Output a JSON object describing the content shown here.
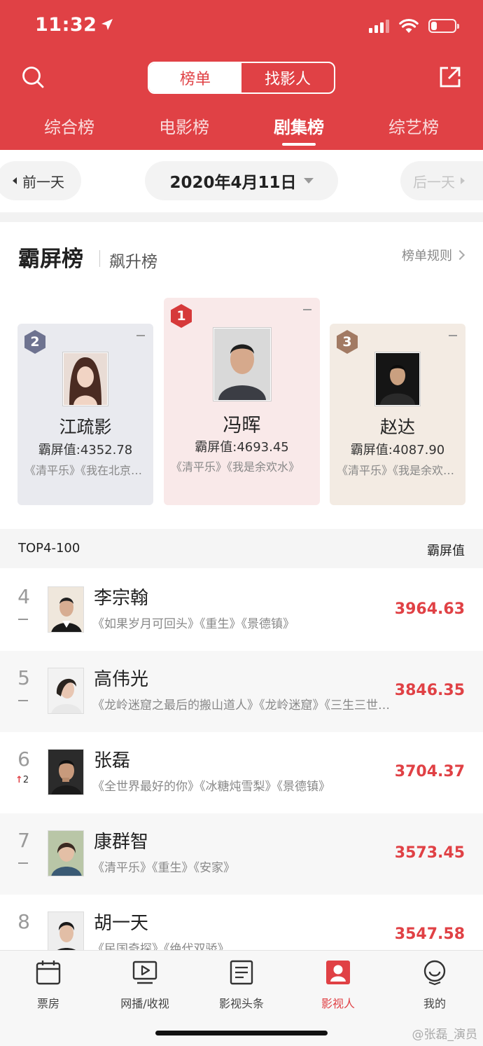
{
  "status_bar": {
    "time": "11:32",
    "location_arrow": "location-arrow-icon",
    "battery_level": 0.25
  },
  "header": {
    "segment": {
      "active": "榜单",
      "inactive": "找影人"
    },
    "tabs": [
      "综合榜",
      "电影榜",
      "剧集榜",
      "综艺榜"
    ],
    "active_tab": "剧集榜",
    "accent_color": "#e04145"
  },
  "date_bar": {
    "prev": "前一天",
    "date": "2020年4月11日",
    "next": "后一天"
  },
  "ranking": {
    "title": "霸屏榜",
    "subtitle": "飙升榜",
    "rules": "榜单规则"
  },
  "podium": [
    {
      "rank": "1",
      "name": "冯晖",
      "score": "霸屏值:4693.45",
      "works": "《清平乐》《我是余欢水》",
      "badge_color": "#d6393a"
    },
    {
      "rank": "2",
      "name": "江疏影",
      "score": "霸屏值:4352.78",
      "works": "《清平乐》《我在北京等你》",
      "badge_color": "#6e7390"
    },
    {
      "rank": "3",
      "name": "赵达",
      "score": "霸屏值:4087.90",
      "works": "《清平乐》《我是余欢水》",
      "badge_color": "#a27a63"
    }
  ],
  "list": {
    "header_left": "TOP4-100",
    "header_right": "霸屏值",
    "rows": [
      {
        "rank": "4",
        "name": "李宗翰",
        "works": "《如果岁月可回头》《重生》《景德镇》",
        "score": "3964.63",
        "trend": ""
      },
      {
        "rank": "5",
        "name": "高伟光",
        "works": "《龙岭迷窟之最后的搬山道人》《龙岭迷窟》《三生三世十里桃花》",
        "score": "3846.35",
        "trend": ""
      },
      {
        "rank": "6",
        "name": "张磊",
        "works": "《全世界最好的你》《冰糖炖雪梨》《景德镇》",
        "score": "3704.37",
        "trend": "2"
      },
      {
        "rank": "7",
        "name": "康群智",
        "works": "《清平乐》《重生》《安家》",
        "score": "3573.45",
        "trend": ""
      },
      {
        "rank": "8",
        "name": "胡一天",
        "works": "《民国奇探》《绝代双骄》",
        "score": "3547.58",
        "trend": ""
      }
    ]
  },
  "bottom_nav": [
    {
      "label": "票房",
      "icon": "calendar-icon"
    },
    {
      "label": "网播/收视",
      "icon": "play-icon"
    },
    {
      "label": "影视头条",
      "icon": "news-icon"
    },
    {
      "label": "影视人",
      "icon": "person-icon",
      "active": true
    },
    {
      "label": "我的",
      "icon": "smile-icon"
    }
  ],
  "watermark": "@张磊_演员"
}
